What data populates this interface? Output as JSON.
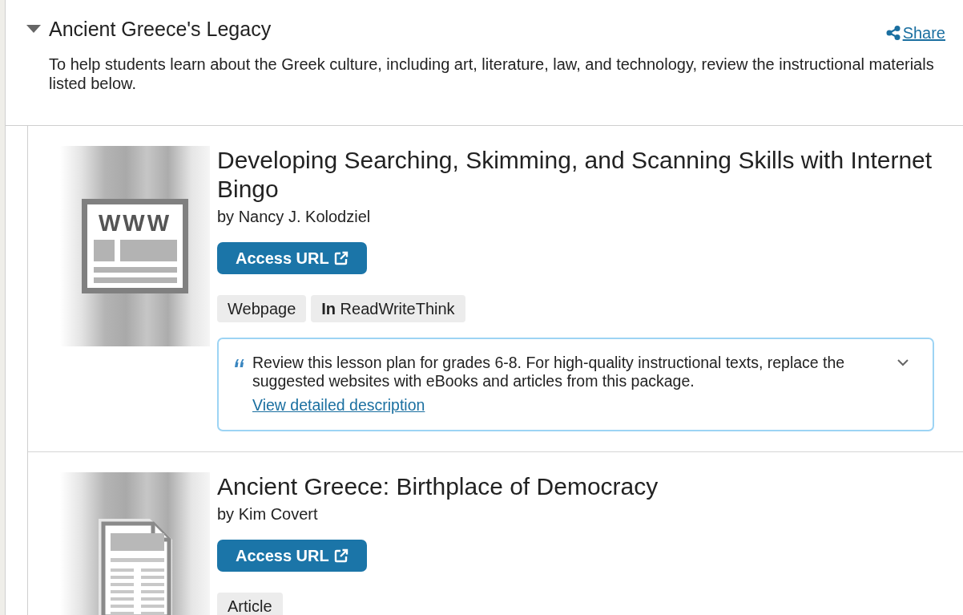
{
  "section": {
    "title": "Ancient Greece's Legacy",
    "expanded": true,
    "share_label": "Share",
    "description": "To help students learn about the Greek culture, including art, literature, law, and technology, review the instructional materials listed below."
  },
  "resources": [
    {
      "thumbnail": {
        "kind": "webpage",
        "label": "WWW"
      },
      "title": "Developing Searching, Skimming, and Scanning Skills with Internet Bingo",
      "author": "by Nancy J. Kolodziel",
      "button_label": "Access URL",
      "tags": [
        "Webpage",
        "**In** ReadWriteThink"
      ],
      "note": {
        "text": "Review this lesson plan for grades 6-8. For high-quality instructional texts, replace the suggested websites with eBooks and articles from this package.",
        "link": "View detailed description",
        "expanded": false
      }
    },
    {
      "thumbnail": {
        "kind": "article"
      },
      "title": "Ancient Greece: Birthplace of Democracy",
      "author": "by Kim Covert",
      "button_label": "Access URL",
      "tags": [
        "Article"
      ]
    }
  ]
}
